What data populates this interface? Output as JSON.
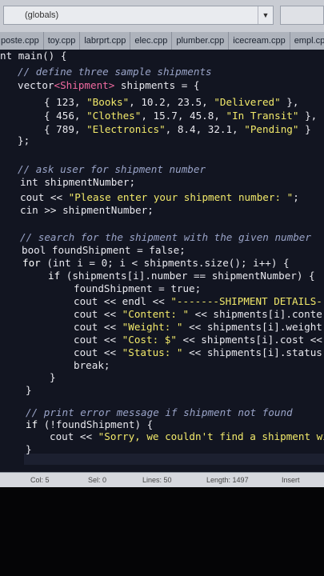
{
  "toolbar": {
    "scope_combo": "(globals)"
  },
  "tabs": [
    {
      "label": "poste.cpp"
    },
    {
      "label": "toy.cpp"
    },
    {
      "label": "labrprt.cpp"
    },
    {
      "label": "elec.cpp"
    },
    {
      "label": "plumber.cpp"
    },
    {
      "label": "icecream.cpp"
    },
    {
      "label": "empl.cpp"
    }
  ],
  "code": {
    "l1_type": "nt",
    "l1_rest": " main() {",
    "l2": "// define three sample shipments",
    "l3_type": "vector",
    "l3_tmpl": "<Shipment>",
    "l3_rest": " shipments = {",
    "l4_a": "{ 123, ",
    "l4_s1": "\"Books\"",
    "l4_b": ", 10.2, 23.5, ",
    "l4_s2": "\"Delivered\"",
    "l4_c": " },",
    "l5_a": "{ 456, ",
    "l5_s1": "\"Clothes\"",
    "l5_b": ", 15.7, 45.8, ",
    "l5_s2": "\"In Transit\"",
    "l5_c": " },",
    "l6_a": "{ 789, ",
    "l6_s1": "\"Electronics\"",
    "l6_b": ", 8.4, 32.1, ",
    "l6_s2": "\"Pending\"",
    "l6_c": " }",
    "l7": "};",
    "l8": "// ask user for shipment number",
    "l9_type": "int",
    "l9_rest": " shipmentNumber;",
    "l10_a": "cout << ",
    "l10_s": "\"Please enter your shipment number: \"",
    "l10_b": ";",
    "l11": "cin >> shipmentNumber;",
    "l12": "// search for the shipment with the given number",
    "l13_type": "bool",
    "l13_rest": " foundShipment = false;",
    "l14_kw": "for",
    "l14_a": " (",
    "l14_type": "int",
    "l14_b": " i = 0; i < shipments.size(); i++) {",
    "l15_kw": "if",
    "l15_rest": " (shipments[i].number == shipmentNumber) {",
    "l16": "foundShipment = true;",
    "l17_a": "cout << endl << ",
    "l17_s": "\"-------SHIPMENT DETAILS--",
    "l18_a": "cout << ",
    "l18_s": "\"Content: \"",
    "l18_b": " << shipments[i].conter",
    "l19_a": "cout << ",
    "l19_s": "\"Weight: \"",
    "l19_b": " << shipments[i].weight",
    "l20_a": "cout << ",
    "l20_s": "\"Cost: $\"",
    "l20_b": " << shipments[i].cost <<",
    "l21_a": "cout << ",
    "l21_s": "\"Status: \"",
    "l21_b": " << shipments[i].status",
    "l22": "break;",
    "l23": "}",
    "l24": "}",
    "l25": "// print error message if shipment not found",
    "l26_kw": "if",
    "l26_rest": " (!foundShipment) {",
    "l27_a": "cout << ",
    "l27_s": "\"Sorry, we couldn't find a shipment wit",
    "l28": "}"
  },
  "status": {
    "col_label": "Col:",
    "col_value": "5",
    "sel_label": "Sel:",
    "sel_value": "0",
    "lines_label": "Lines:",
    "lines_value": "50",
    "length_label": "Length:",
    "length_value": "1497",
    "mode": "Insert"
  }
}
